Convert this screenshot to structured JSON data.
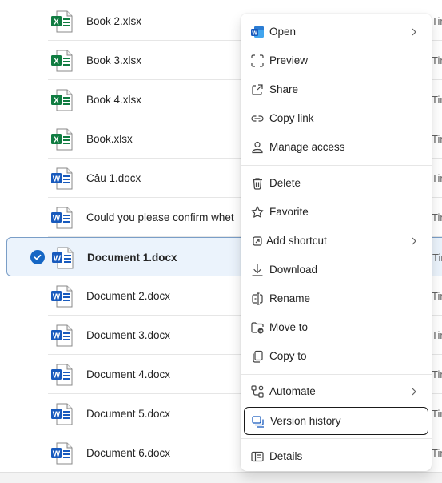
{
  "files": [
    {
      "name": "Book 2.xlsx",
      "type": "excel",
      "tail": "Tin"
    },
    {
      "name": "Book 3.xlsx",
      "type": "excel",
      "tail": "Tin"
    },
    {
      "name": "Book 4.xlsx",
      "type": "excel",
      "tail": "Tin"
    },
    {
      "name": "Book.xlsx",
      "type": "excel",
      "tail": "Tin"
    },
    {
      "name": "Câu 1.docx",
      "type": "word",
      "tail": "Tin"
    },
    {
      "name": "Could you please confirm whet",
      "type": "word",
      "tail": "Tin"
    },
    {
      "name": "Document 1.docx",
      "type": "word",
      "tail": "Tin",
      "selected": true
    },
    {
      "name": "Document 2.docx",
      "type": "word",
      "tail": "Tin"
    },
    {
      "name": "Document 3.docx",
      "type": "word",
      "tail": "Tin"
    },
    {
      "name": "Document 4.docx",
      "type": "word",
      "tail": "Tin"
    },
    {
      "name": "Document 5.docx",
      "type": "word",
      "tail": "Tin"
    },
    {
      "name": "Document 6.docx",
      "type": "word",
      "tail": "Tin"
    }
  ],
  "menu": {
    "open": "Open",
    "preview": "Preview",
    "share": "Share",
    "copy_link": "Copy link",
    "manage_access": "Manage access",
    "delete": "Delete",
    "favorite": "Favorite",
    "add_shortcut": "Add shortcut",
    "download": "Download",
    "rename": "Rename",
    "move_to": "Move to",
    "copy_to": "Copy to",
    "automate": "Automate",
    "version_history": "Version history",
    "details": "Details"
  },
  "colors": {
    "excel": "#107c41",
    "word": "#185abd",
    "selection_bg": "#ebf3fc",
    "check": "#1566c4"
  },
  "icons": {
    "open": "word-app-icon",
    "preview": "preview-icon",
    "share": "share-icon",
    "copy_link": "link-icon",
    "manage_access": "person-icon",
    "delete": "trash-icon",
    "favorite": "star-icon",
    "add_shortcut": "shortcut-icon",
    "download": "download-icon",
    "rename": "rename-icon",
    "move_to": "folder-move-icon",
    "copy_to": "copy-icon",
    "automate": "flow-icon",
    "version_history": "version-history-icon",
    "details": "details-icon"
  }
}
